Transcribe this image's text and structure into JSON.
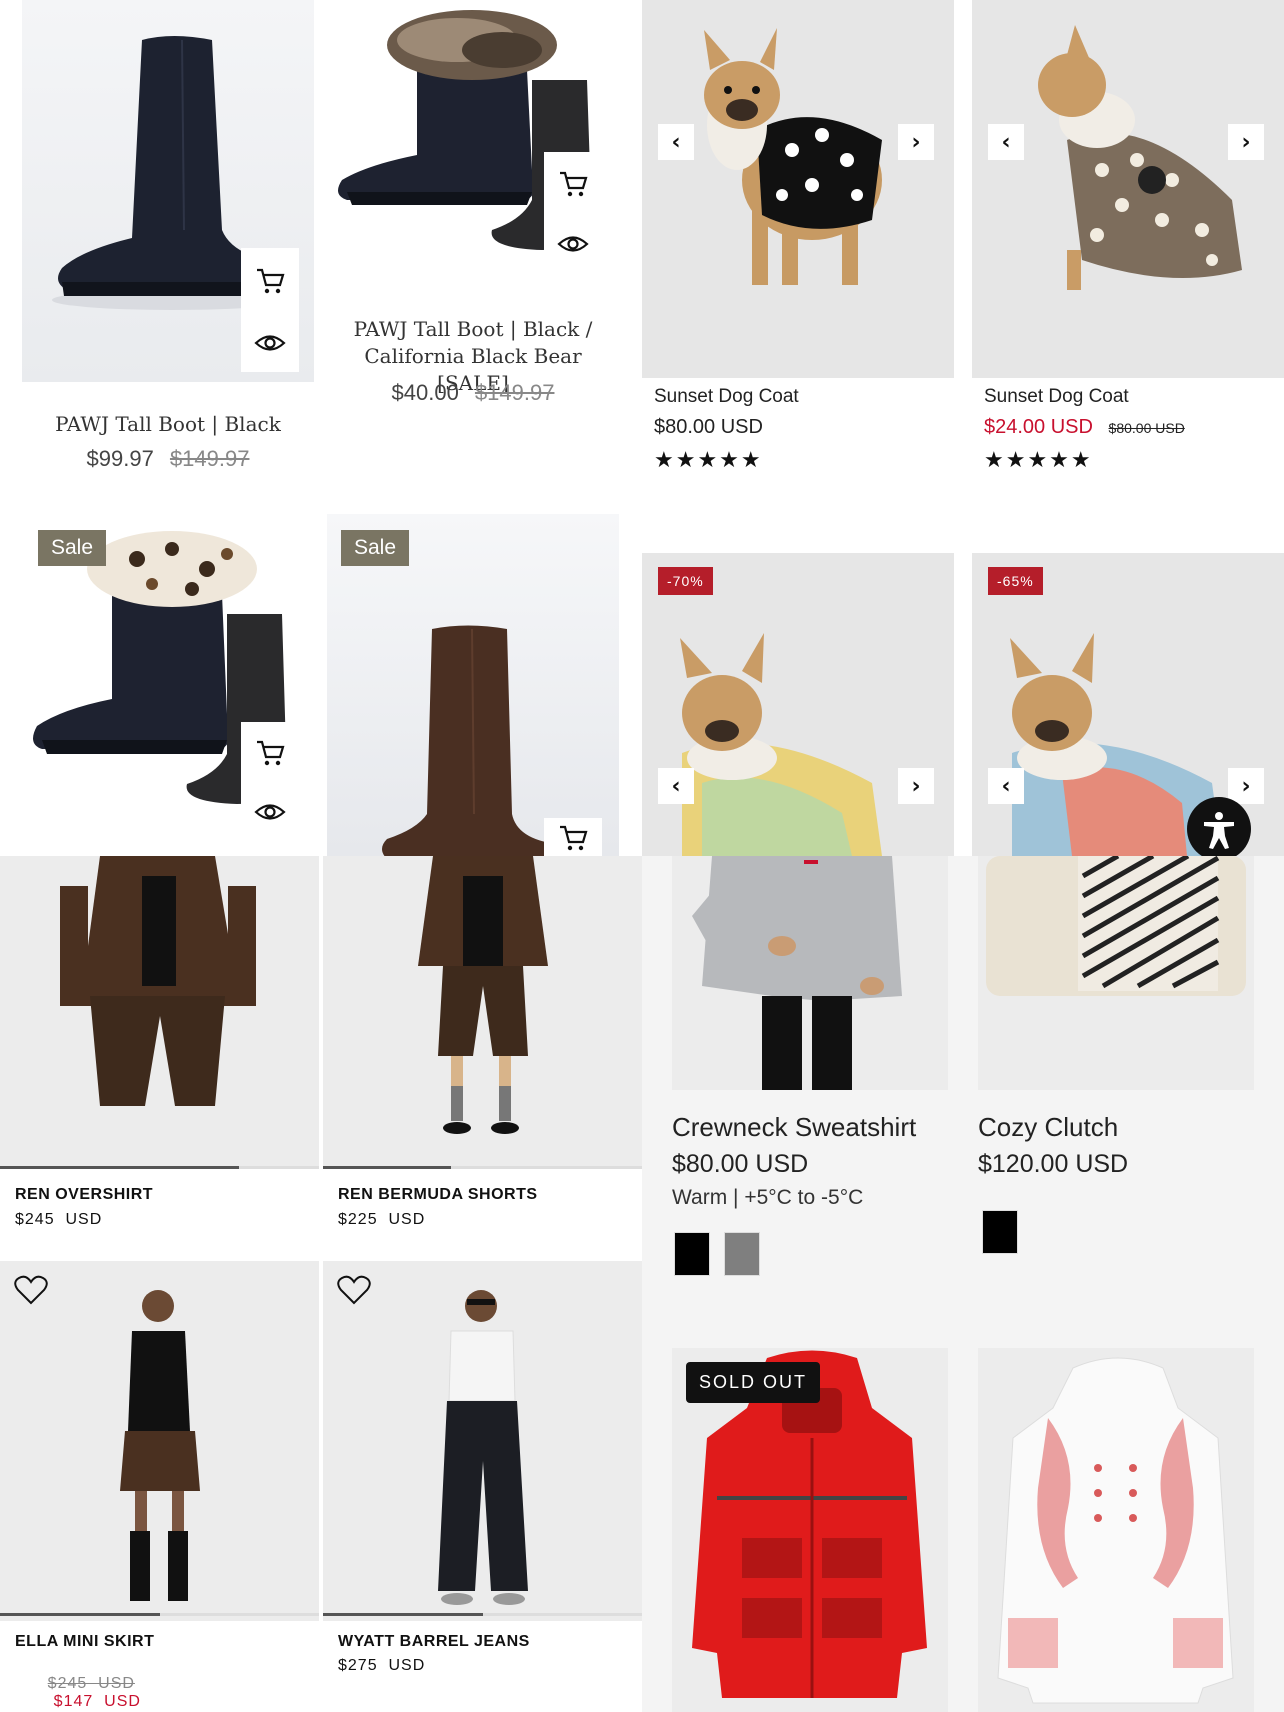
{
  "boots": {
    "p1": {
      "title": "PAWJ Tall Boot | Black",
      "price": "$99.97",
      "compare": "$149.97"
    },
    "p2": {
      "title_line1": "PAWJ Tall Boot | Black /",
      "title_line2": "California Black Bear [SALE]",
      "price": "$40.00",
      "compare": "$149.97"
    },
    "p3": {
      "badge": "Sale"
    },
    "p4": {
      "badge": "Sale"
    }
  },
  "dogs": {
    "p1": {
      "title": "Sunset Dog Coat",
      "price": "$80.00 USD",
      "stars": "★★★★★"
    },
    "p2": {
      "title": "Sunset Dog Coat",
      "price": "$24.00 USD",
      "compare": "$80.00 USD",
      "stars": "★★★★★"
    },
    "p3": {
      "badge": "-70%"
    },
    "p4": {
      "badge": "-65%"
    }
  },
  "fashion": {
    "p1": {
      "title": "REN OVERSHIRT",
      "price": "$245  USD"
    },
    "p2": {
      "title": "REN BERMUDA SHORTS",
      "price": "$225  USD"
    },
    "p3": {
      "title": "ELLA MINI SKIRT",
      "compare": "$245  USD",
      "price": "$147  USD"
    },
    "p4": {
      "title": "WYATT BARREL JEANS",
      "price": "$275  USD"
    }
  },
  "outerwear": {
    "p1": {
      "title": "Crewneck Sweatshirt",
      "price": "$80.00 USD",
      "note": "Warm | +5°C to -5°C"
    },
    "p2": {
      "title": "Cozy Clutch",
      "price": "$120.00 USD"
    },
    "p3": {
      "badge": "SOLD OUT"
    }
  },
  "colors": {
    "sale_badge": "#7a7563",
    "discount_badge": "#b51e2a",
    "sale_price": "#c8102e",
    "strike": "#888888"
  },
  "icons": {
    "cart": "cart-icon",
    "eye": "eye-icon",
    "prev": "chevron-left-icon",
    "next": "chevron-right-icon",
    "heart": "heart-icon",
    "accessibility": "accessibility-icon"
  }
}
